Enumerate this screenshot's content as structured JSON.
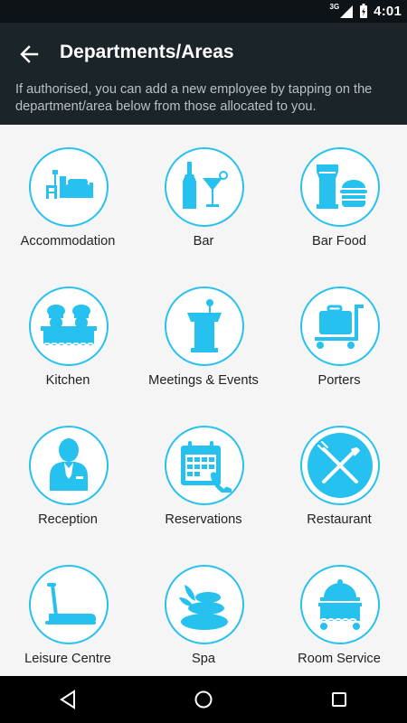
{
  "status_bar": {
    "network": "3G",
    "time": "4:01"
  },
  "header": {
    "title": "Departments/Areas",
    "subtitle": "If authorised, you can add a new employee by tapping on the department/area below from those allocated to you."
  },
  "departments": [
    {
      "label": "Accommodation",
      "icon": "bed-icon"
    },
    {
      "label": "Bar",
      "icon": "bottle-cocktail-icon"
    },
    {
      "label": "Bar Food",
      "icon": "beer-burger-icon"
    },
    {
      "label": "Kitchen",
      "icon": "chefs-icon"
    },
    {
      "label": "Meetings & Events",
      "icon": "podium-icon"
    },
    {
      "label": "Porters",
      "icon": "luggage-trolley-icon"
    },
    {
      "label": "Reception",
      "icon": "receptionist-icon"
    },
    {
      "label": "Reservations",
      "icon": "calendar-phone-icon"
    },
    {
      "label": "Restaurant",
      "icon": "fork-knife-icon"
    },
    {
      "label": "Leisure Centre",
      "icon": "treadmill-icon"
    },
    {
      "label": "Spa",
      "icon": "spa-stones-icon"
    },
    {
      "label": "Room Service",
      "icon": "cloche-trolley-icon"
    }
  ],
  "colors": {
    "accent": "#27c1f0",
    "app_bar": "#1b2429",
    "status_bar": "#0d1316"
  },
  "nav": {
    "back": "back-triangle-icon",
    "home": "home-circle-icon",
    "recents": "recents-square-icon"
  }
}
